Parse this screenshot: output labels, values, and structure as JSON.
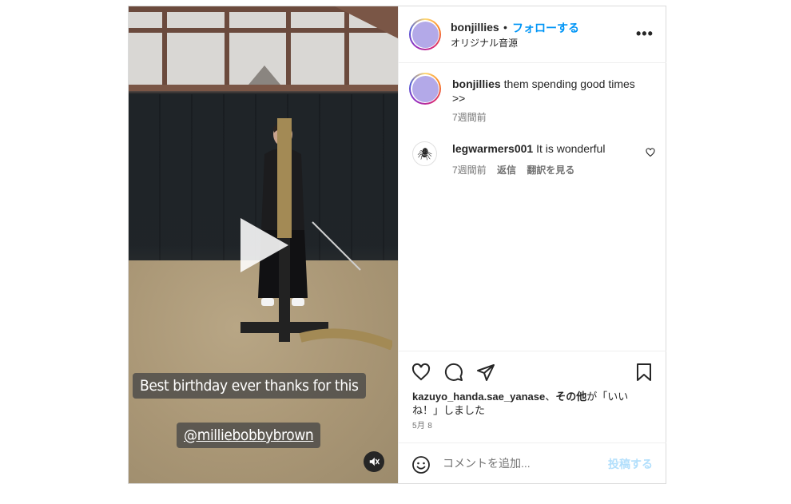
{
  "media": {
    "caption_lines": [
      "Best birthday ever thanks for this",
      "@milliebobbybrown"
    ],
    "play_icon": "play-icon",
    "mute_icon": "muted-speaker-icon"
  },
  "header": {
    "username": "bonjillies",
    "separator": "•",
    "follow_label": "フォローする",
    "audio_label": "オリジナル音源",
    "more_label": "•••"
  },
  "comments": [
    {
      "username": "bonjillies",
      "text": "them spending good times >>",
      "time": "7週間前"
    },
    {
      "username": "legwarmers001",
      "text": "It is wonderful",
      "time": "7週間前",
      "reply_label": "返信",
      "translate_label": "翻訳を見る",
      "avatar_glyph": "🕷"
    }
  ],
  "actions": {
    "likers": "kazuyo_handa.sae_yanase",
    "likes_mid": "、",
    "others_label": "その他",
    "likes_suffix": "が「いいね！」しました",
    "date": "5月 8"
  },
  "composer": {
    "placeholder": "コメントを追加...",
    "post_label": "投稿する"
  },
  "colors": {
    "accent": "#0095f6",
    "post_disabled": "#b2dffc",
    "muted_text": "#737373",
    "avatar_fill": "#b3a9e8"
  }
}
